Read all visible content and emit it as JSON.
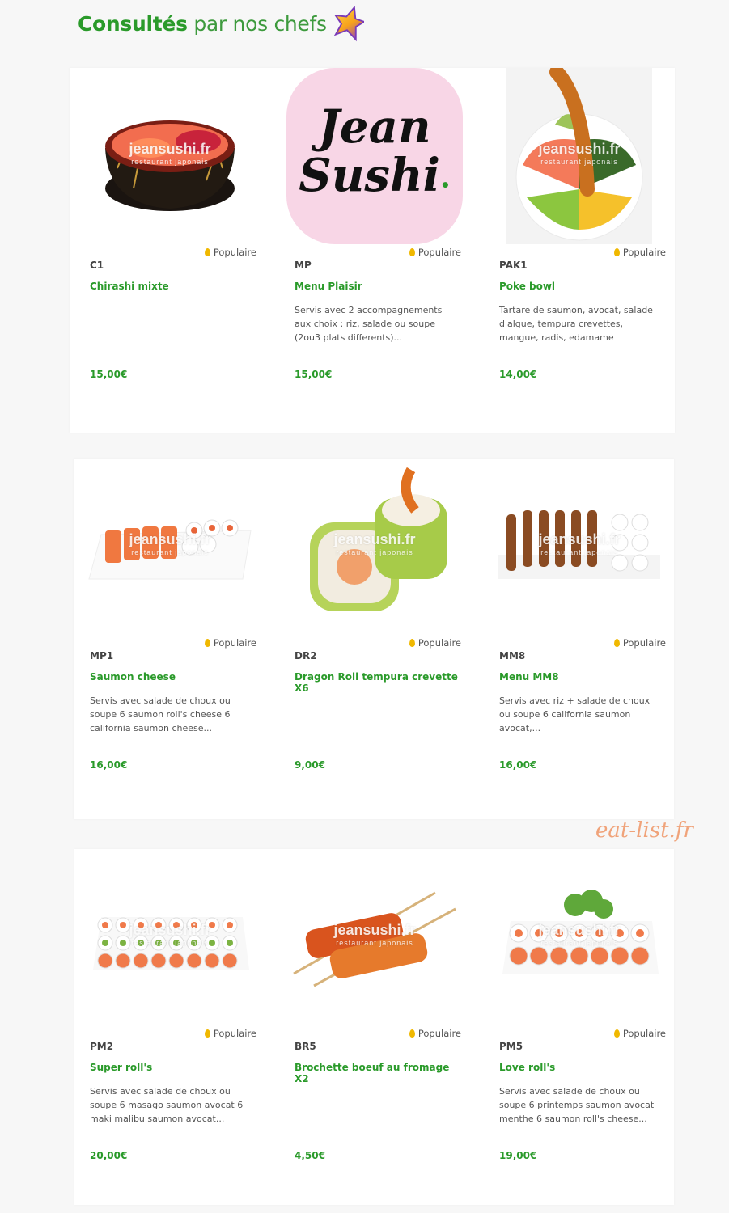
{
  "header": {
    "title_bold": "Consultés",
    "title_light": "par nos chefs"
  },
  "colors": {
    "accent": "#2a9a2a",
    "popular_icon": "#f0b800",
    "watermark_corner": "#f0a37a"
  },
  "popular_label": "Populaire",
  "watermark": {
    "site": "jeansushi.fr",
    "tag": "restaurant japonais"
  },
  "logo_text": {
    "line1": "Jean",
    "line2": "Sushi"
  },
  "products": [
    {
      "code": "C1",
      "name": "Chirashi mixte",
      "description": "",
      "price": "15,00€",
      "image": "chirashi-bowl"
    },
    {
      "code": "MP",
      "name": "Menu Plaisir",
      "description": "Servis avec 2 accompagnements aux choix : riz, salade ou soupe (2ou3 plats differents)...",
      "price": "15,00€",
      "image": "jean-sushi-logo"
    },
    {
      "code": "PAK1",
      "name": "Poke bowl",
      "description": "Tartare de saumon, avocat, salade d'algue, tempura crevettes, mangue, radis, edamame",
      "price": "14,00€",
      "image": "poke-bowl"
    },
    {
      "code": "MP1",
      "name": "Saumon cheese",
      "description": "Servis avec salade de choux ou soupe 6 saumon roll's cheese 6 california saumon cheese...",
      "price": "16,00€",
      "image": "salmon-rolls"
    },
    {
      "code": "DR2",
      "name": "Dragon Roll tempura crevette X6",
      "description": "",
      "price": "9,00€",
      "image": "dragon-roll"
    },
    {
      "code": "MM8",
      "name": "Menu MM8",
      "description": "Servis avec riz + salade de choux ou soupe 6 california saumon avocat,...",
      "price": "16,00€",
      "image": "skewers-platter"
    },
    {
      "code": "PM2",
      "name": "Super roll's",
      "description": "Servis avec salade de choux ou soupe 6 masago saumon avocat 6 maki malibu saumon avocat...",
      "price": "20,00€",
      "image": "rolls-platter"
    },
    {
      "code": "BR5",
      "name": "Brochette boeuf au fromage X2",
      "description": "",
      "price": "4,50€",
      "image": "beef-cheese-skewers"
    },
    {
      "code": "PM5",
      "name": "Love roll's",
      "description": "Servis avec salade de choux ou soupe 6 printemps saumon avocat menthe 6 saumon roll's cheese...",
      "price": "19,00€",
      "image": "love-rolls"
    }
  ],
  "corner_watermark": "eat-list.fr"
}
